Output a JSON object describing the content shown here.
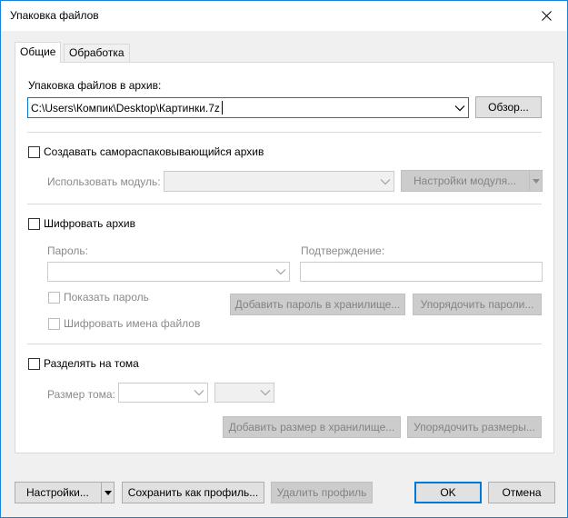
{
  "window": {
    "title": "Упаковка файлов"
  },
  "tabs": [
    {
      "label": "Общие",
      "active": true
    },
    {
      "label": "Обработка",
      "active": false
    }
  ],
  "archive": {
    "label": "Упаковка файлов в архив:",
    "path": "C:\\Users\\Компик\\Desktop\\Картинки.7z",
    "browse_label": "Обзор..."
  },
  "sfx": {
    "checkbox_label": "Создавать самораспаковывающийся архив",
    "module_label": "Использовать модуль:",
    "module_settings_label": "Настройки модуля..."
  },
  "encryption": {
    "checkbox_label": "Шифровать архив",
    "password_label": "Пароль:",
    "confirm_label": "Подтверждение:",
    "show_password_label": "Показать пароль",
    "add_password_label": "Добавить пароль в хранилище...",
    "organize_passwords_label": "Упорядочить пароли...",
    "encrypt_names_label": "Шифровать имена файлов"
  },
  "split": {
    "checkbox_label": "Разделять на тома",
    "volume_size_label": "Размер тома:",
    "add_size_label": "Добавить размер в хранилище...",
    "organize_sizes_label": "Упорядочить размеры..."
  },
  "footer": {
    "settings_label": "Настройки...",
    "save_profile_label": "Сохранить как профиль...",
    "delete_profile_label": "Удалить профиль",
    "ok_label": "OK",
    "cancel_label": "Отмена"
  },
  "colors": {
    "accent": "#0078d7",
    "disabled_text": "#8a8a8a"
  }
}
